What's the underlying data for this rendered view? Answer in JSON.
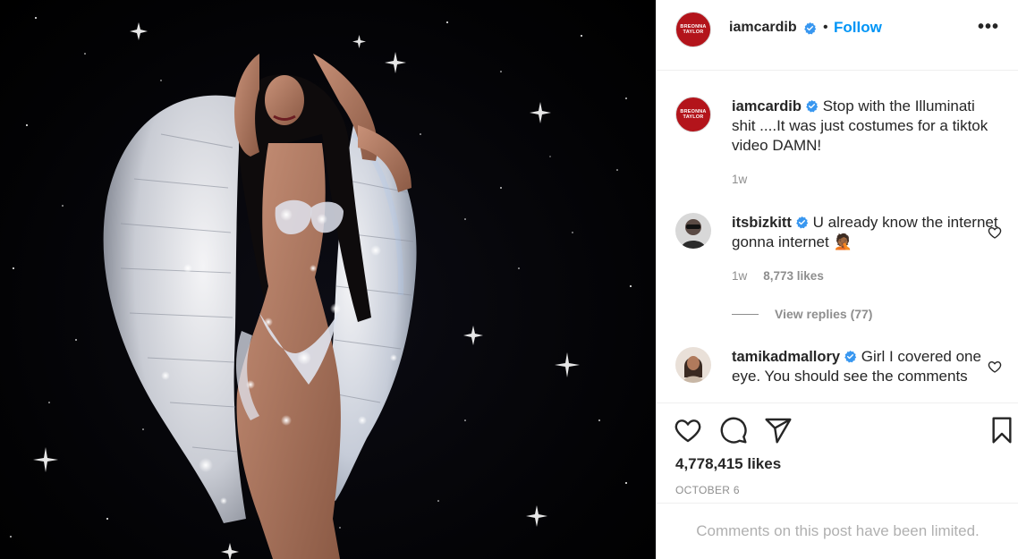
{
  "post": {
    "author": "iamcardib",
    "follow_label": "Follow",
    "separator": "•",
    "more_label": "•••",
    "avatar_text_line1": "BREONNA",
    "avatar_text_line2": "TAYLOR"
  },
  "comments": [
    {
      "username": "iamcardib",
      "text": "Stop with the Illuminati shit ....It was just costumes for a tiktok video DAMN!",
      "time": "1w"
    },
    {
      "username": "itsbizkitt",
      "text": "U already know the internet gonna internet",
      "emoji": "🤦🏾",
      "time": "1w",
      "likes": "8,773 likes",
      "view_replies": "View replies (77)"
    },
    {
      "username": "tamikadmallory",
      "text": "Girl I covered one eye. You should see the comments"
    }
  ],
  "footer": {
    "likes": "4,778,415 likes",
    "date": "OCTOBER 6",
    "limited_notice": "Comments on this post have been limited."
  },
  "colors": {
    "accent": "#0095f6",
    "verified": "#3897f0",
    "brand_red": "#b3141b"
  },
  "icons": [
    "heart-icon",
    "comment-icon",
    "share-icon",
    "save-icon",
    "verified-icon",
    "more-icon"
  ]
}
